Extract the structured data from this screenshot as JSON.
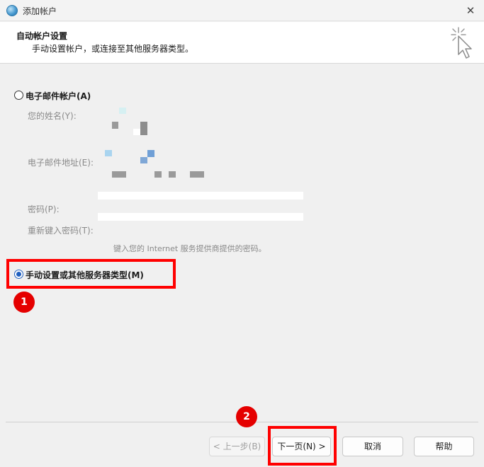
{
  "window": {
    "title": "添加帐户",
    "close_glyph": "✕"
  },
  "header": {
    "title": "自动帐户设置",
    "subtitle": "手动设置帐户，或连接至其他服务器类型。",
    "icon": "cursor-sparkle-icon"
  },
  "email_option": {
    "label": "电子邮件帐户(A)",
    "selected": false,
    "fields": {
      "name_label": "您的姓名(Y):",
      "email_label": "电子邮件地址(E):",
      "password_label": "密码(P):",
      "retype_label": "重新键入密码(T):"
    },
    "hint": "键入您的 Internet 服务提供商提供的密码。"
  },
  "manual_option": {
    "label": "手动设置或其他服务器类型(M)",
    "selected": true
  },
  "annotations": {
    "badge_1": "1",
    "badge_2": "2"
  },
  "buttons": {
    "back": "< 上一步(B)",
    "next": "下一页(N) >",
    "cancel": "取消",
    "help": "帮助"
  },
  "colors": {
    "highlight": "#ff0000",
    "badge": "#e50000",
    "radio_accent": "#1f5fbf"
  }
}
